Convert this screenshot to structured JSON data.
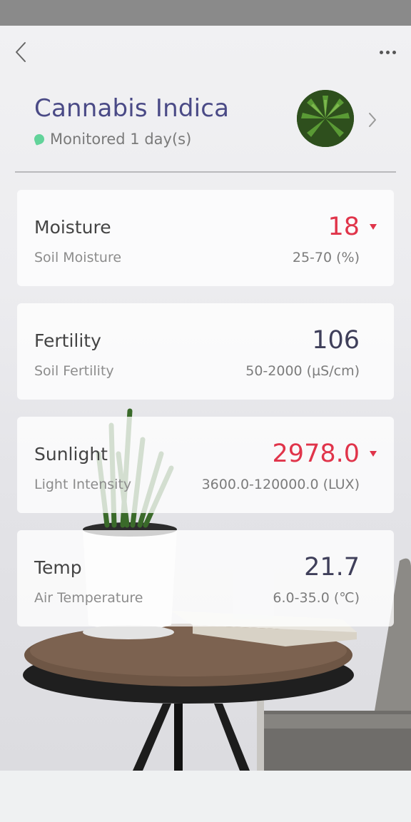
{
  "header": {
    "back_icon": "chevron-left-icon",
    "more_icon": "more-dots-icon"
  },
  "plant": {
    "name": "Cannabis Indica",
    "status": "Monitored 1 day(s)",
    "status_color": "#62d39a"
  },
  "metrics": [
    {
      "title": "Moisture",
      "subtitle": "Soil Moisture",
      "value": "18",
      "range": "25-70 (%)",
      "alert": true
    },
    {
      "title": "Fertility",
      "subtitle": "Soil Fertility",
      "value": "106",
      "range": "50-2000 (µS/cm)",
      "alert": false
    },
    {
      "title": "Sunlight",
      "subtitle": "Light Intensity",
      "value": "2978.0",
      "range": "3600.0-120000.0 (LUX)",
      "alert": true
    },
    {
      "title": "Temp",
      "subtitle": "Air Temperature",
      "value": "21.7",
      "range": "6.0-35.0 (℃)",
      "alert": false
    }
  ],
  "colors": {
    "title": "#4a4a86",
    "alert": "#e0344a",
    "value_normal": "#3f3f5a",
    "status_bar": "#8a8a8a"
  }
}
